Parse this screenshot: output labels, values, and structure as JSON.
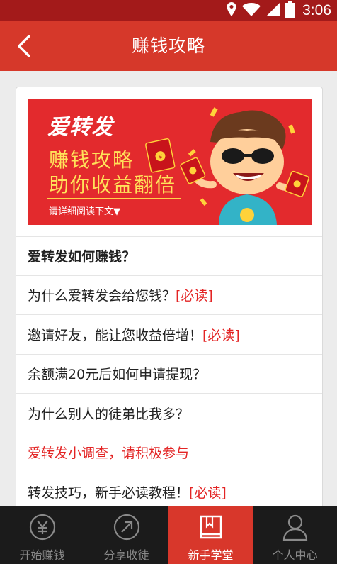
{
  "status_bar": {
    "time": "3:06",
    "icons": [
      "location-icon",
      "wifi-icon",
      "signal-icon",
      "battery-icon"
    ]
  },
  "app_bar": {
    "title": "赚钱攻略",
    "back_icon": "chevron-left-icon"
  },
  "banner": {
    "logo": "爱转发",
    "line1": "赚钱攻略",
    "line2": "助你收益翻倍",
    "hint": "请详细阅读下文▼"
  },
  "list": {
    "items": [
      {
        "text": "爱转发如何赚钱？",
        "suffix": "",
        "style": "header"
      },
      {
        "text": "为什么爱转发会给您钱？",
        "suffix": "[必读]",
        "style": "normal"
      },
      {
        "text": "邀请好友，能让您收益倍增！",
        "suffix": "[必读]",
        "style": "normal"
      },
      {
        "text": "余额满20元后如何申请提现？",
        "suffix": "",
        "style": "normal"
      },
      {
        "text": "为什么别人的徒弟比我多？",
        "suffix": "",
        "style": "normal"
      },
      {
        "text": "爱转发小调查，请积极参与",
        "suffix": "",
        "style": "red"
      },
      {
        "text": "转发技巧，新手必读教程！",
        "suffix": "[必读]",
        "style": "normal"
      }
    ]
  },
  "tab_bar": {
    "tabs": [
      {
        "label": "开始赚钱",
        "icon": "yen-circle-icon",
        "active": false
      },
      {
        "label": "分享收徒",
        "icon": "share-arrow-icon",
        "active": false
      },
      {
        "label": "新手学堂",
        "icon": "book-icon",
        "active": true
      },
      {
        "label": "个人中心",
        "icon": "person-icon",
        "active": false
      }
    ]
  },
  "colors": {
    "app_bar": "#d6382a",
    "status_bar": "#a31a1a",
    "accent_red": "#e32424",
    "tab_bar": "#1b1b1b"
  }
}
